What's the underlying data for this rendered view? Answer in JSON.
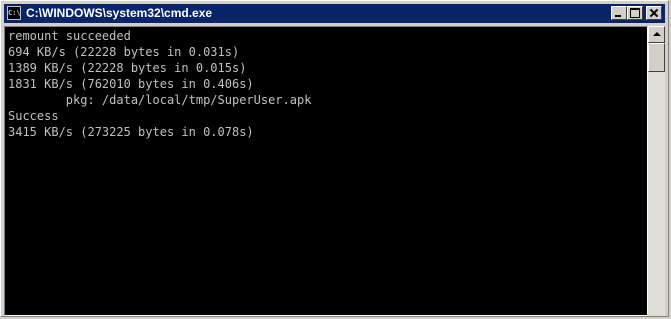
{
  "window": {
    "title": "C:\\WINDOWS\\system32\\cmd.exe",
    "icon": "cmd-icon",
    "icon_glyph": "C:\\"
  },
  "console": {
    "lines": [
      "remount succeeded",
      "694 KB/s (22228 bytes in 0.031s)",
      "1389 KB/s (22228 bytes in 0.015s)",
      "1831 KB/s (762010 bytes in 0.406s)",
      "        pkg: /data/local/tmp/SuperUser.apk",
      "Success",
      "3415 KB/s (273225 bytes in 0.078s)"
    ]
  },
  "colors": {
    "titlebar": "#0a246a",
    "console_bg": "#000000",
    "console_text": "#c0c0c0"
  }
}
